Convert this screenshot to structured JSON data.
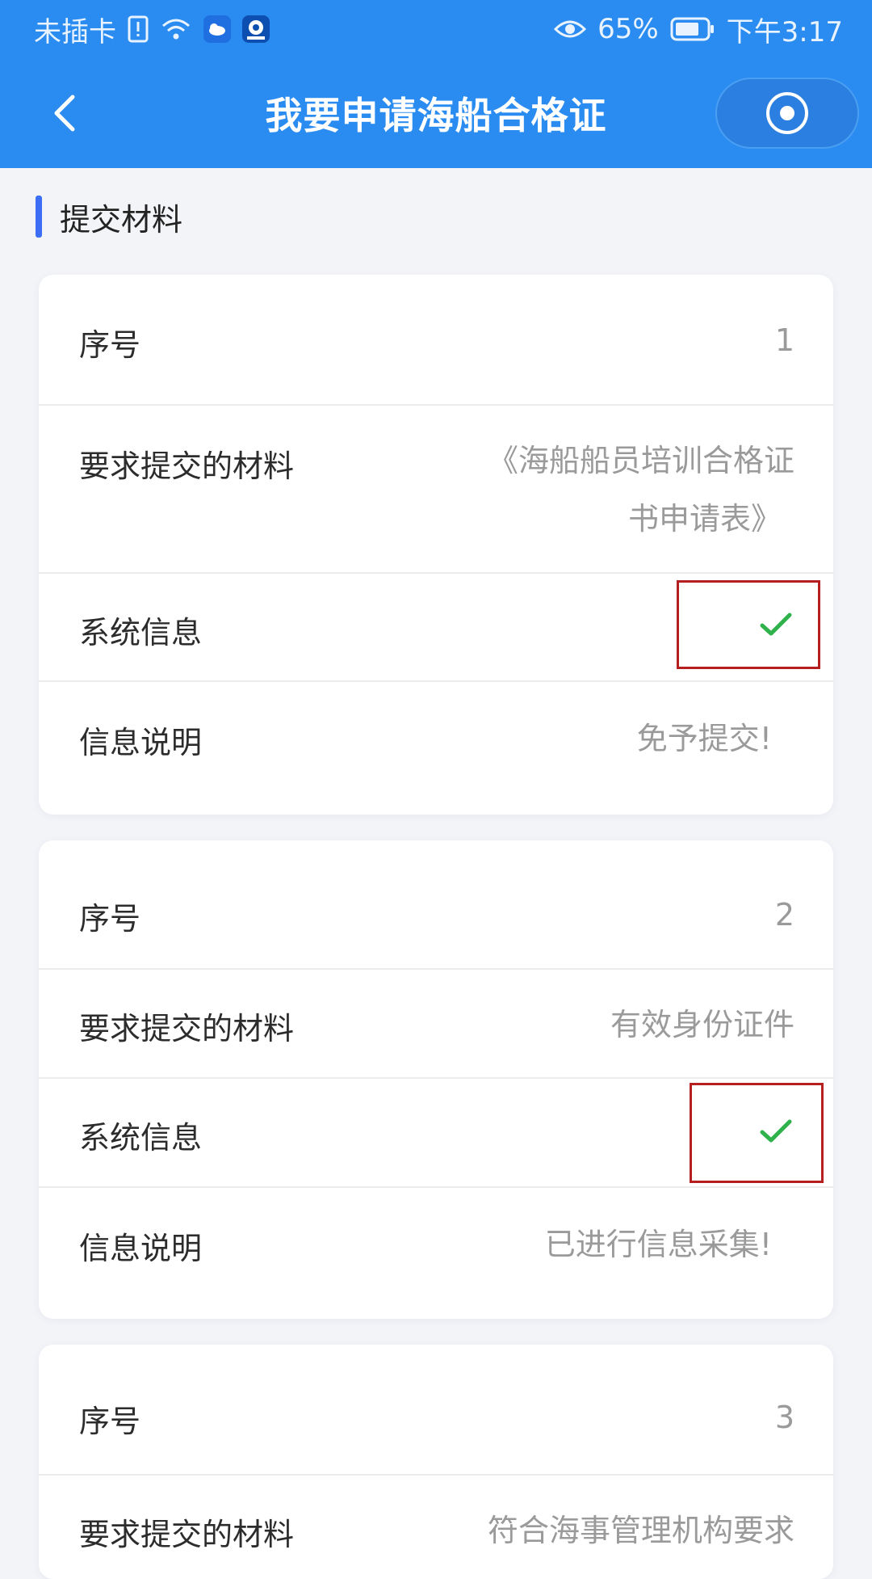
{
  "status": {
    "carrier": "未插卡",
    "battery": "65%",
    "time": "下午3:17"
  },
  "nav": {
    "title": "我要申请海船合格证"
  },
  "section": {
    "title": "提交材料"
  },
  "cards": [
    {
      "seq_label": "序号",
      "seq_value": "1",
      "material_label": "要求提交的材料",
      "material_value_line1": "《海船船员培训合格证",
      "material_value_line2": "书申请表》",
      "sysinfo_label": "系统信息",
      "note_label": "信息说明",
      "note_value": "免予提交!"
    },
    {
      "seq_label": "序号",
      "seq_value": "2",
      "material_label": "要求提交的材料",
      "material_value_line1": "有效身份证件",
      "sysinfo_label": "系统信息",
      "note_label": "信息说明",
      "note_value": "已进行信息采集!"
    },
    {
      "seq_label": "序号",
      "seq_value": "3",
      "material_label": "要求提交的材料",
      "material_value_line1": "符合海事管理机构要求"
    }
  ],
  "colors": {
    "primary": "#2a8cf0",
    "accent_bar": "#3b6ef5",
    "check": "#2fb24c",
    "highlight_box": "#b51f1f"
  }
}
